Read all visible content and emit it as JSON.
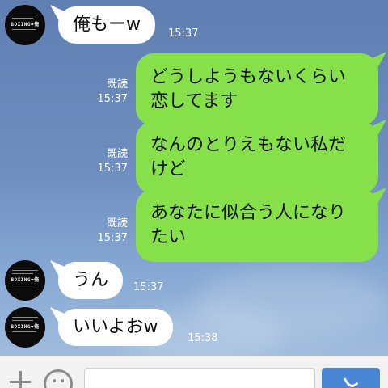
{
  "contact": {
    "avatar_text": "BOXING❤俺"
  },
  "messages": [
    {
      "side": "in",
      "text": "俺もーw",
      "time": "15:37"
    },
    {
      "side": "out",
      "read_label": "既読",
      "time": "15:37",
      "lines": [
        "どうしようもないくらい",
        "恋してます"
      ]
    },
    {
      "side": "out",
      "read_label": "既読",
      "time": "15:37",
      "lines": [
        "なんのとりえもない私だ",
        "けど"
      ]
    },
    {
      "side": "out",
      "read_label": "既読",
      "time": "15:37",
      "lines": [
        "あなたに似合う人になり",
        "たい"
      ]
    },
    {
      "side": "in",
      "text": "うん",
      "time": "15:37"
    },
    {
      "side": "in",
      "text": "いいよおw",
      "time": "15:38"
    }
  ],
  "composer": {
    "plus_icon": "plus-icon",
    "emoji_icon": "smiley-icon",
    "input_value": "",
    "call_icon": "phone-icon"
  },
  "colors": {
    "outgoing_bubble": "#86e04a",
    "incoming_bubble": "#ffffff",
    "call_button": "#4a86d6"
  }
}
